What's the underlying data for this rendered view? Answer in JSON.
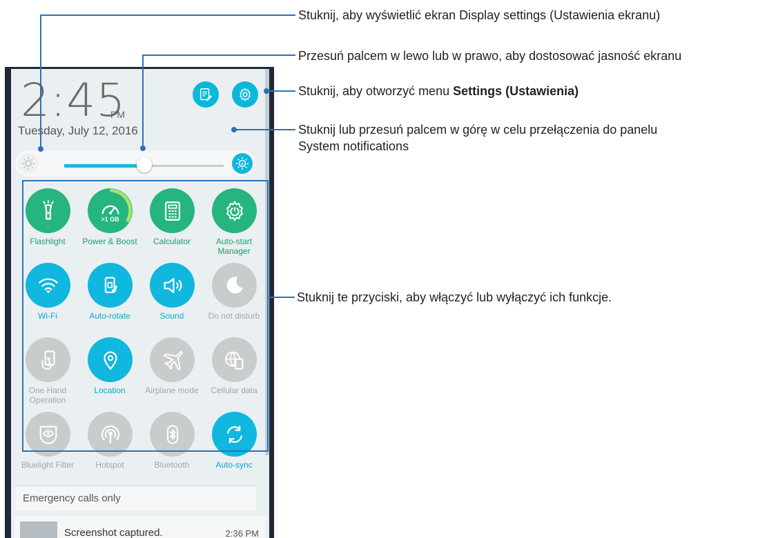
{
  "clock": {
    "time": "2:45",
    "ampm": "PM",
    "date": "Tuesday, July 12, 2016"
  },
  "top_buttons": [
    "edit-notes-icon",
    "settings-gear-icon"
  ],
  "brightness": {
    "level": 0.5,
    "low_icon": "sun-low-icon",
    "auto_icon": "auto-brightness-icon"
  },
  "quick_settings": [
    {
      "label": "Flashlight",
      "icon": "flashlight-icon",
      "state": "green"
    },
    {
      "label": "Power & Boost",
      "icon": "speedometer-icon",
      "state": "green",
      "badge": ">1 GB"
    },
    {
      "label": "Calculator",
      "icon": "calculator-icon",
      "state": "green"
    },
    {
      "label": "Auto-start Manager",
      "icon": "gear-power-icon",
      "state": "green"
    },
    {
      "label": "Wi-Fi",
      "icon": "wifi-icon",
      "state": "blue"
    },
    {
      "label": "Auto-rotate",
      "icon": "rotate-icon",
      "state": "blue"
    },
    {
      "label": "Sound",
      "icon": "speaker-icon",
      "state": "blue"
    },
    {
      "label": "Do not disturb",
      "icon": "moon-icon",
      "state": "off"
    },
    {
      "label": "One Hand Operation",
      "icon": "one-hand-icon",
      "state": "off"
    },
    {
      "label": "Location",
      "icon": "location-pin-icon",
      "state": "blue"
    },
    {
      "label": "Airplane mode",
      "icon": "airplane-icon",
      "state": "off"
    },
    {
      "label": "Cellular data",
      "icon": "globe-phone-icon",
      "state": "off"
    },
    {
      "label": "Bluelight Filter",
      "icon": "eye-shield-icon",
      "state": "off"
    },
    {
      "label": "Hotspot",
      "icon": "hotspot-icon",
      "state": "off"
    },
    {
      "label": "Bluetooth",
      "icon": "bluetooth-icon",
      "state": "off"
    },
    {
      "label": "Auto-sync",
      "icon": "sync-icon",
      "state": "blue"
    }
  ],
  "status": {
    "emergency": "Emergency calls only"
  },
  "notification": {
    "title": "Screenshot captured.",
    "time": "2:36 PM"
  },
  "annotations": {
    "display_settings": "Stuknij, aby wyświetlić ekran Display settings (Ustawienia ekranu)",
    "brightness": "Przesuń palcem w lewo lub w prawo, aby dostosować jasność ekranu",
    "settings_prefix": "Stuknij, aby otworzyć menu ",
    "settings_bold": "Settings (Ustawienia)",
    "system_notifications_1": "Stuknij lub przesuń palcem w górę w celu przełączenia do panelu",
    "system_notifications_2": "System notifications",
    "toggles": "Stuknij te przyciski, aby włączyć lub wyłączyć ich funkcje."
  },
  "colors": {
    "green": "#26b57e",
    "blue": "#10b7de",
    "off": "#c9cccd",
    "callout": "#2a72b8"
  }
}
